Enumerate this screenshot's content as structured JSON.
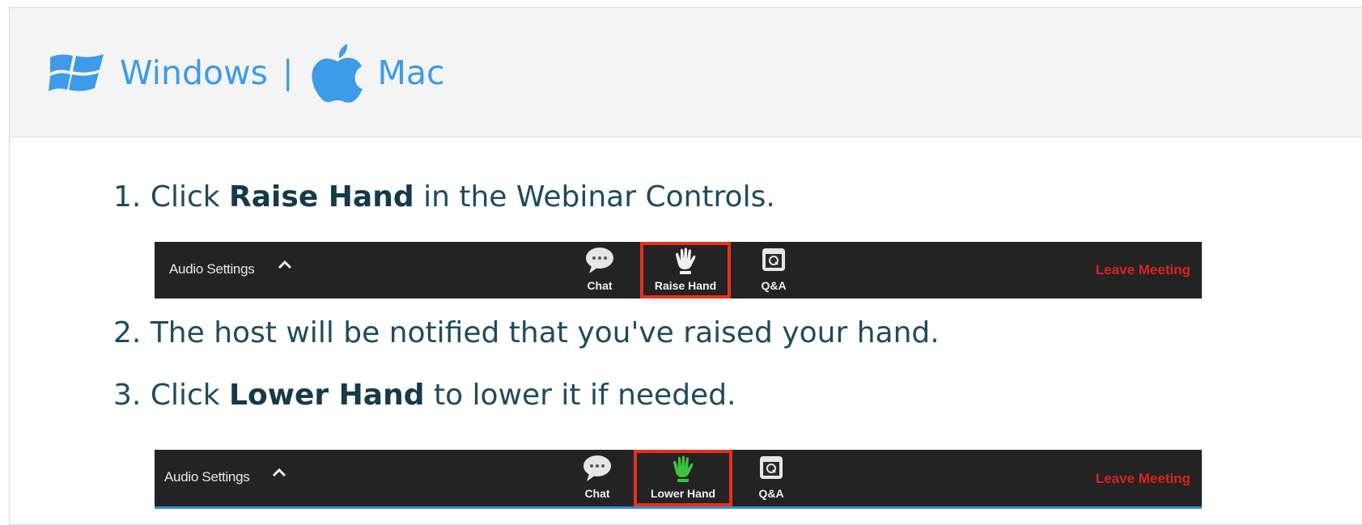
{
  "header": {
    "windows_label": "Windows",
    "separator": "|",
    "mac_label": "Mac"
  },
  "steps": [
    {
      "num": "1.",
      "pre": "Click",
      "bold": "Raise Hand",
      "post": "in the Webinar Controls."
    },
    {
      "num": "2.",
      "text": "The host will be notified that you've raised your hand."
    },
    {
      "num": "3.",
      "pre": "Click",
      "bold": "Lower Hand",
      "post": "to lower it if needed."
    }
  ],
  "toolbar1": {
    "audio_label": "Audio Settings",
    "chat_label": "Chat",
    "hand_label": "Raise Hand",
    "qa_label": "Q&A",
    "leave_label": "Leave Meeting"
  },
  "toolbar2": {
    "audio_label": "Audio Settings",
    "chat_label": "Chat",
    "hand_label": "Lower Hand",
    "qa_label": "Q&A",
    "leave_label": "Leave Meeting"
  },
  "colors": {
    "link": "#3d9be9",
    "highlight": "#e8301b",
    "leave": "#e02020",
    "raised_hand": "#3cc43c"
  },
  "icons": {
    "windows": "windows-logo-icon",
    "mac": "apple-logo-icon",
    "chat": "chat-bubble-icon",
    "raise_hand": "hand-icon",
    "qa": "qa-icon",
    "caret": "chevron-up-icon"
  }
}
